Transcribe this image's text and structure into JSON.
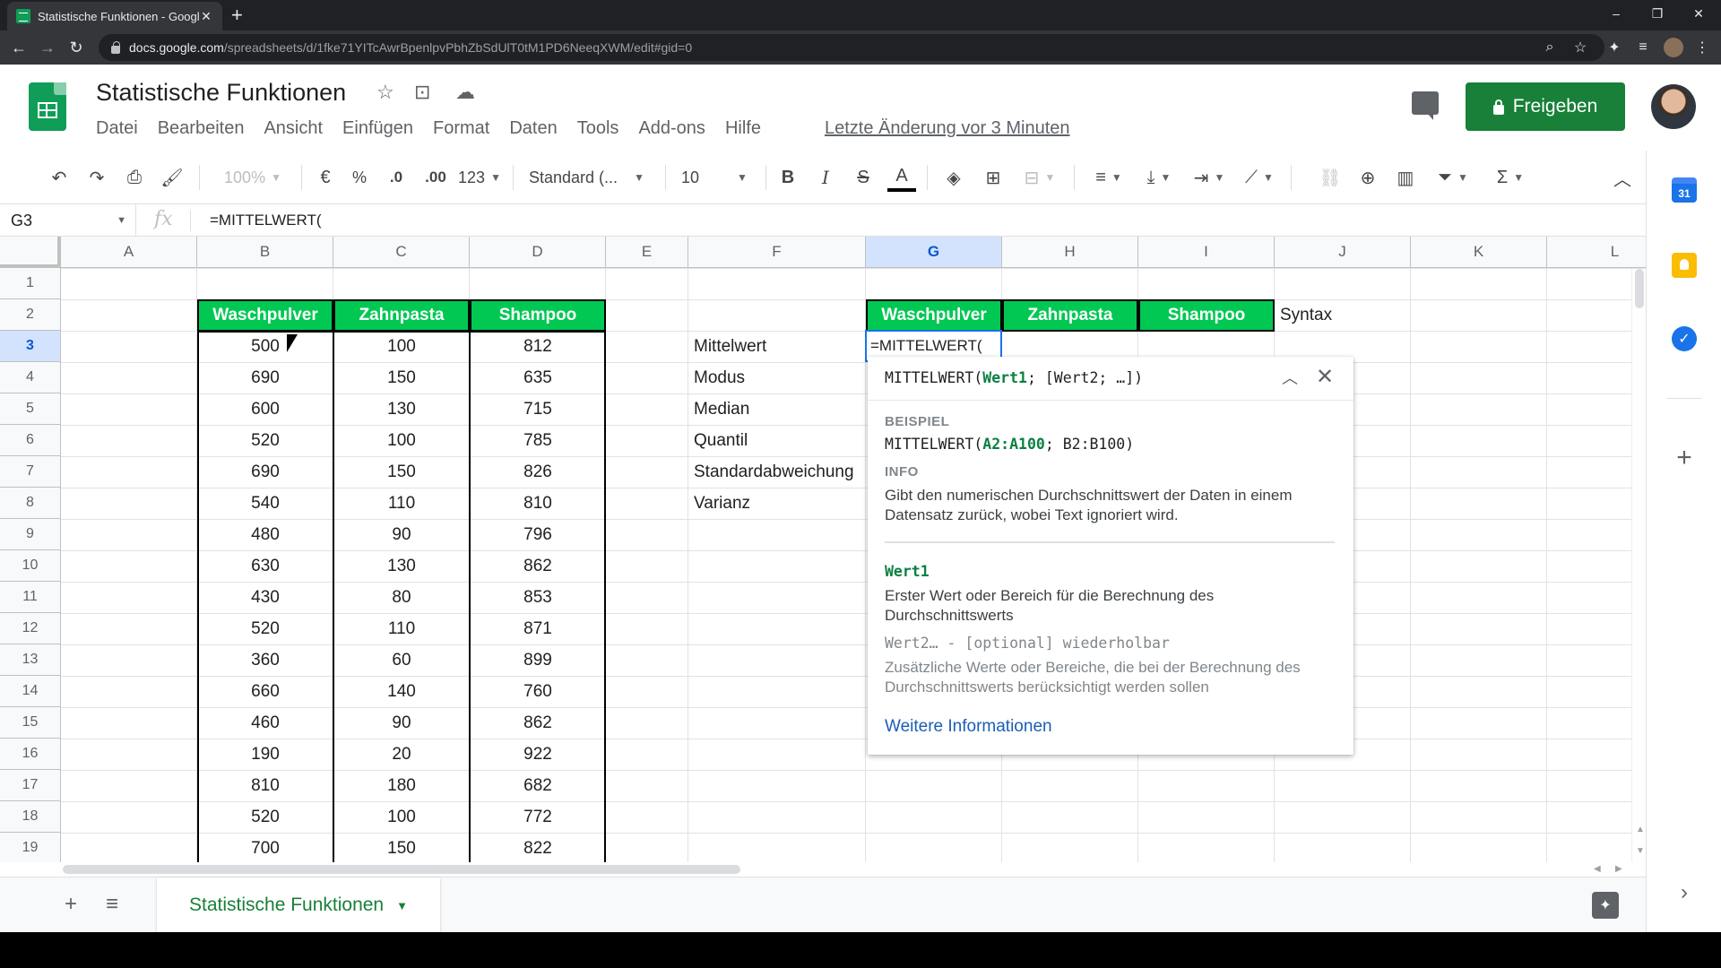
{
  "browser": {
    "tab_title": "Statistische Funktionen - Google",
    "tab_close": "✕",
    "new_tab": "+",
    "url_host": "docs.google.com",
    "url_path": "/spreadsheets/d/1fke71YITcAwrBpenlpvPbhZbSdUlT0tM1PD6NeeqXWM/edit#gid=0",
    "win_minimize": "–",
    "win_restore": "❐",
    "win_close": "✕"
  },
  "app": {
    "doc_title": "Statistische Funktionen",
    "menu": [
      "Datei",
      "Bearbeiten",
      "Ansicht",
      "Einfügen",
      "Format",
      "Daten",
      "Tools",
      "Add-ons",
      "Hilfe"
    ],
    "last_edit": "Letzte Änderung vor 3 Minuten",
    "share_label": "Freigeben"
  },
  "toolbar": {
    "zoom": "100%",
    "currency": "€",
    "percent": "%",
    "dec_decrease": ".0",
    "dec_increase": ".00",
    "more_formats": "123",
    "font": "Standard (...",
    "font_size": "10",
    "bold": "B",
    "italic": "I",
    "strike": "S",
    "text_color": "A",
    "sum": "Σ"
  },
  "formula_bar": {
    "name_box": "G3",
    "fx": "fx",
    "formula": "=MITTELWERT("
  },
  "grid": {
    "columns": [
      "A",
      "B",
      "C",
      "D",
      "E",
      "F",
      "G",
      "H",
      "I",
      "J",
      "K",
      "L"
    ],
    "rows": [
      "1",
      "2",
      "3",
      "4",
      "5",
      "6",
      "7",
      "8",
      "9",
      "10",
      "11",
      "12",
      "13",
      "14",
      "15",
      "16",
      "17",
      "18",
      "19"
    ],
    "left_table": {
      "headers": [
        "Waschpulver",
        "Zahnpasta",
        "Shampoo"
      ],
      "rows": [
        [
          "500",
          "100",
          "812"
        ],
        [
          "690",
          "150",
          "635"
        ],
        [
          "600",
          "130",
          "715"
        ],
        [
          "520",
          "100",
          "785"
        ],
        [
          "690",
          "150",
          "826"
        ],
        [
          "540",
          "110",
          "810"
        ],
        [
          "480",
          "90",
          "796"
        ],
        [
          "630",
          "130",
          "862"
        ],
        [
          "430",
          "80",
          "853"
        ],
        [
          "520",
          "110",
          "871"
        ],
        [
          "360",
          "60",
          "899"
        ],
        [
          "660",
          "140",
          "760"
        ],
        [
          "460",
          "90",
          "862"
        ],
        [
          "190",
          "20",
          "922"
        ],
        [
          "810",
          "180",
          "682"
        ],
        [
          "520",
          "100",
          "772"
        ],
        [
          "700",
          "150",
          "822"
        ]
      ]
    },
    "stat_labels": [
      "Mittelwert",
      "Modus",
      "Median",
      "Quantil",
      "Standardabweichung",
      "Varianz"
    ],
    "right_headers": [
      "Waschpulver",
      "Zahnpasta",
      "Shampoo"
    ],
    "syntax_label": "Syntax",
    "active_cell_value": "=MITTELWERT("
  },
  "help_popup": {
    "sig_func": "MITTELWERT(",
    "sig_arg1": "Wert1",
    "sig_rest": "; [Wert2; …])",
    "example_label": "BEISPIEL",
    "example_func": "MITTELWERT(",
    "example_range1": "A2:A100",
    "example_rest": "; B2:B100)",
    "info_label": "INFO",
    "info_text": "Gibt den numerischen Durchschnittswert der Daten in einem Datensatz zurück, wobei Text ignoriert wird.",
    "arg1_name": "Wert1",
    "arg1_desc": "Erster Wert oder Bereich für die Berechnung des Durchschnittswerts",
    "arg2_name": "Wert2… - [optional] wiederholbar",
    "arg2_desc": "Zusätzliche Werte oder Bereiche, die bei der Berechnung des Durchschnittswerts berücksichtigt werden sollen",
    "more_info": "Weitere Informationen"
  },
  "sheets": {
    "active_tab": "Statistische Funktionen"
  },
  "side_panel": {
    "calendar_day": "31"
  },
  "colors": {
    "header_green": "#00c853",
    "share_green": "#188038",
    "selection_blue": "#1a73e8"
  }
}
